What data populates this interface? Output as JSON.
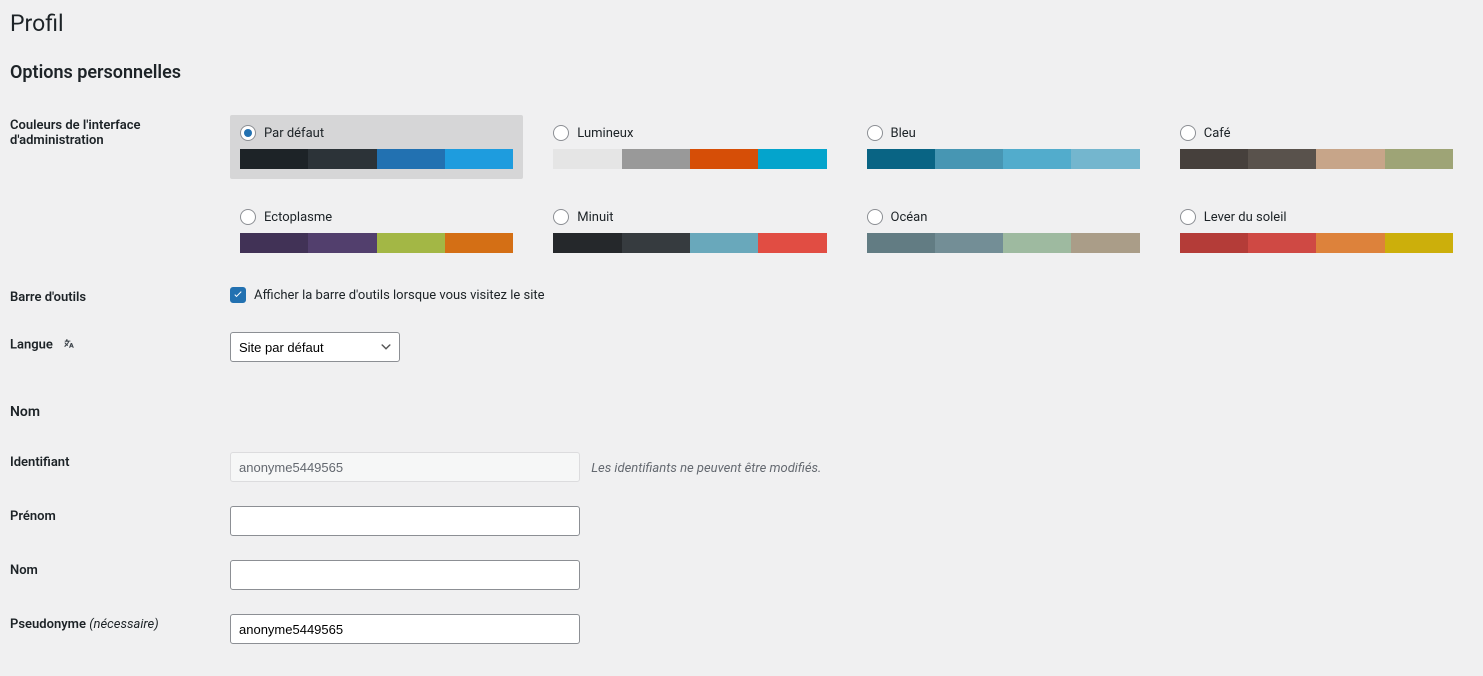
{
  "page": {
    "title": "Profil"
  },
  "sections": {
    "personal": "Options personnelles",
    "name": "Nom"
  },
  "labels": {
    "colors": "Couleurs de l'interface d'administration",
    "toolbar": "Barre d'outils",
    "toolbar_cb": "Afficher la barre d'outils lorsque vous visitez le site",
    "language": "Langue",
    "identifier": "Identifiant",
    "identifier_desc": "Les identifiants ne peuvent être modifiés.",
    "firstname": "Prénom",
    "lastname": "Nom",
    "nickname": "Pseudonyme",
    "nickname_req": "(nécessaire)"
  },
  "language_select": "Site par défaut",
  "fields": {
    "identifier": "anonyme5449565",
    "firstname": "",
    "lastname": "",
    "nickname": "anonyme5449565"
  },
  "colors": [
    {
      "name": "Par défaut",
      "selected": true,
      "c": [
        "#1d2327",
        "#2c3338",
        "#2271b1",
        "#1e9cde"
      ]
    },
    {
      "name": "Lumineux",
      "selected": false,
      "c": [
        "#e5e5e5",
        "#999999",
        "#d64e07",
        "#04a4cc"
      ]
    },
    {
      "name": "Bleu",
      "selected": false,
      "c": [
        "#096484",
        "#4796b3",
        "#52accc",
        "#74b6ce"
      ]
    },
    {
      "name": "Café",
      "selected": false,
      "c": [
        "#46403c",
        "#59524c",
        "#c7a589",
        "#9ea476"
      ]
    },
    {
      "name": "Ectoplasme",
      "selected": false,
      "c": [
        "#413256",
        "#523f6d",
        "#a3b745",
        "#d46f15"
      ]
    },
    {
      "name": "Minuit",
      "selected": false,
      "c": [
        "#25282b",
        "#363b3f",
        "#69a8bb",
        "#e14d43"
      ]
    },
    {
      "name": "Océan",
      "selected": false,
      "c": [
        "#627c83",
        "#738e96",
        "#9ebaa0",
        "#aa9d88"
      ]
    },
    {
      "name": "Lever du soleil",
      "selected": false,
      "c": [
        "#b43c38",
        "#cf4944",
        "#dd823b",
        "#ccaf0b"
      ]
    }
  ]
}
